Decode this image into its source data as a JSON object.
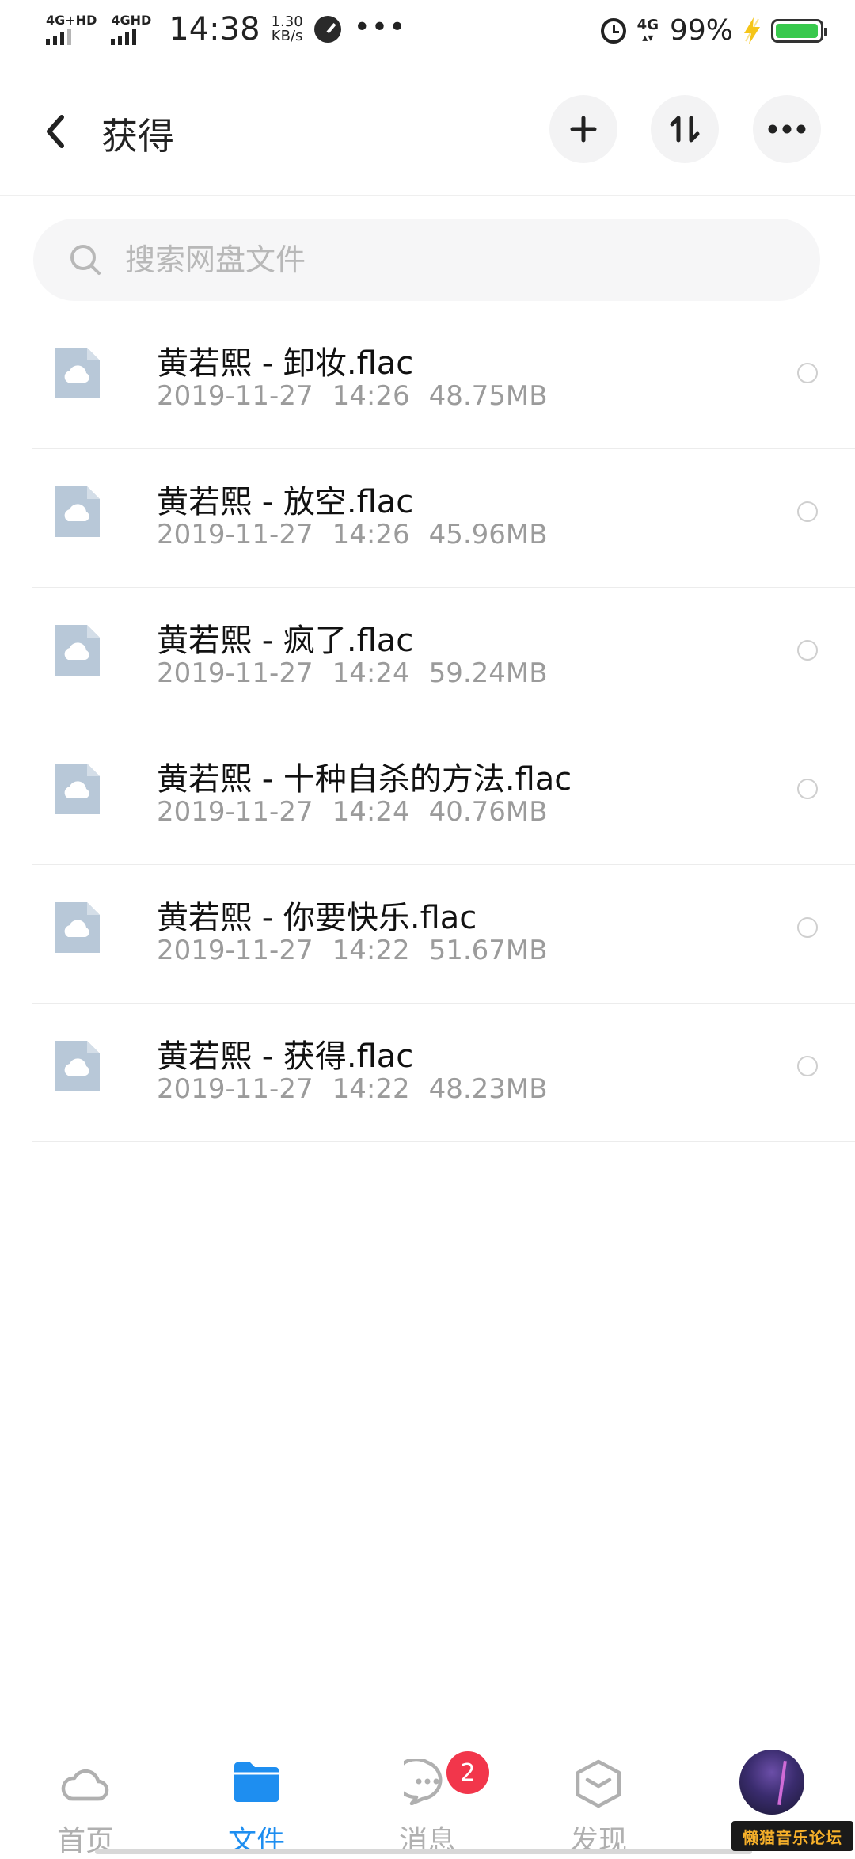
{
  "status_bar": {
    "net1": "4G+HD",
    "net2": "4GHD",
    "time": "14:38",
    "speed_value": "1.30",
    "speed_unit": "KB/s",
    "more": "•••",
    "net_right": "4G",
    "battery": "99%",
    "battery_level": 0.99
  },
  "header": {
    "title": "获得",
    "back_icon": "chevron-left-icon",
    "actions": [
      "plus-icon",
      "sort-icon",
      "more-horizontal-icon"
    ]
  },
  "search": {
    "placeholder": "搜索网盘文件",
    "value": ""
  },
  "files": [
    {
      "name": "黄若熙 - 卸妆.flac",
      "date": "2019-11-27",
      "time": "14:26",
      "size": "48.75MB"
    },
    {
      "name": "黄若熙 - 放空.flac",
      "date": "2019-11-27",
      "time": "14:26",
      "size": "45.96MB"
    },
    {
      "name": "黄若熙 - 疯了.flac",
      "date": "2019-11-27",
      "time": "14:24",
      "size": "59.24MB"
    },
    {
      "name": "黄若熙 - 十种自杀的方法.flac",
      "date": "2019-11-27",
      "time": "14:24",
      "size": "40.76MB"
    },
    {
      "name": "黄若熙 - 你要快乐.flac",
      "date": "2019-11-27",
      "time": "14:22",
      "size": "51.67MB"
    },
    {
      "name": "黄若熙 - 获得.flac",
      "date": "2019-11-27",
      "time": "14:22",
      "size": "48.23MB"
    }
  ],
  "bottom_nav": {
    "items": [
      {
        "label": "首页",
        "icon": "cloud-icon"
      },
      {
        "label": "文件",
        "icon": "folder-icon"
      },
      {
        "label": "消息",
        "icon": "chat-bubble-icon"
      },
      {
        "label": "发现",
        "icon": "cube-icon"
      },
      {
        "label": "",
        "icon": "avatar"
      }
    ],
    "active": 1,
    "message_badge": "2"
  },
  "watermark": "懒猫音乐论坛",
  "colors": {
    "accent": "#1e8ef0",
    "badge": "#f2364b",
    "file_icon": "#b8c8d8",
    "battery": "#38c94d"
  }
}
